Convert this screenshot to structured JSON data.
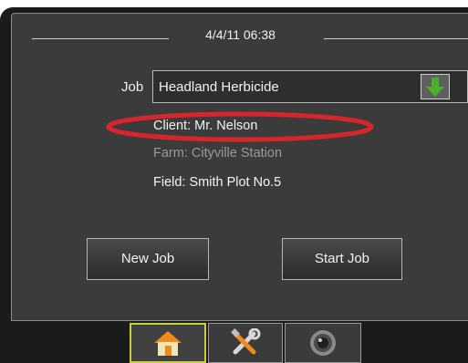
{
  "header": {
    "datetime": "4/4/11 06:38"
  },
  "job": {
    "label": "Job",
    "selected": "Headland Herbicide"
  },
  "details": {
    "client": "Client: Mr. Nelson",
    "farm": "Farm: Cityville Station",
    "field": "Field: Smith Plot No.5"
  },
  "buttons": {
    "new_job": "New Job",
    "start_job": "Start Job"
  },
  "tabs": [
    {
      "icon": "home-icon",
      "active": true
    },
    {
      "icon": "tools-icon",
      "active": false
    },
    {
      "icon": "camera-icon",
      "active": false
    }
  ],
  "colors": {
    "panel": "#3b3b3b",
    "active_tab_border": "#c9cf3a",
    "dropdown_arrow": "#4caf2a",
    "highlight_ellipse": "#d6262d",
    "dimmed_text": "#9a9a9a"
  }
}
